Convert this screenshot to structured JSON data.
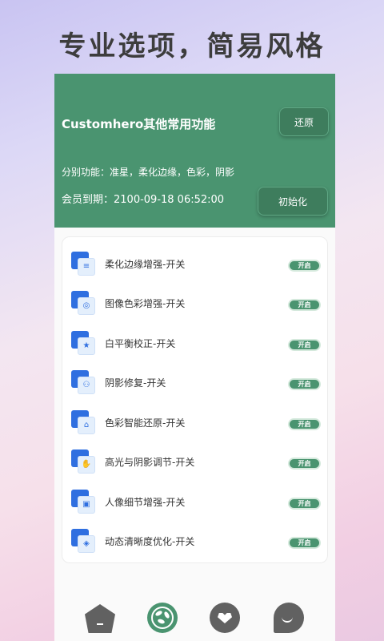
{
  "headline": "专业选项，简易风格",
  "hero": {
    "title": "Customhero其他常用功能",
    "restore_label": "还原",
    "features": "分别功能：准星，柔化边缘，色彩，阴影",
    "member": "会员到期：2100-09-18 06:52:00",
    "init_label": "初始化"
  },
  "settings": [
    {
      "label": "柔化边缘增强-开关",
      "toggle": "开启",
      "icon": "list-icon",
      "glyph": "≡"
    },
    {
      "label": "图像色彩增强-开关",
      "toggle": "开启",
      "icon": "palette-icon",
      "glyph": "◎"
    },
    {
      "label": "白平衡校正-开关",
      "toggle": "开启",
      "icon": "star-icon",
      "glyph": "★"
    },
    {
      "label": "阴影修复-开关",
      "toggle": "开启",
      "icon": "network-icon",
      "glyph": "⚇"
    },
    {
      "label": "色彩智能还原-开关",
      "toggle": "开启",
      "icon": "home-icon",
      "glyph": "⌂"
    },
    {
      "label": "高光与阴影调节-开关",
      "toggle": "开启",
      "icon": "hand-icon",
      "glyph": "✋"
    },
    {
      "label": "人像细节增强-开关",
      "toggle": "开启",
      "icon": "cube-icon",
      "glyph": "▣"
    },
    {
      "label": "动态清晰度优化-开关",
      "toggle": "开启",
      "icon": "box-icon",
      "glyph": "◈"
    }
  ],
  "tabbar": [
    {
      "icon": "home-tab-icon"
    },
    {
      "icon": "fan-tab-icon",
      "active": true
    },
    {
      "icon": "heart-tab-icon"
    },
    {
      "icon": "smile-tab-icon"
    }
  ],
  "colors": {
    "accent": "#4a9470",
    "icon_blue": "#2f6fe0",
    "tab_gray": "#616161"
  }
}
